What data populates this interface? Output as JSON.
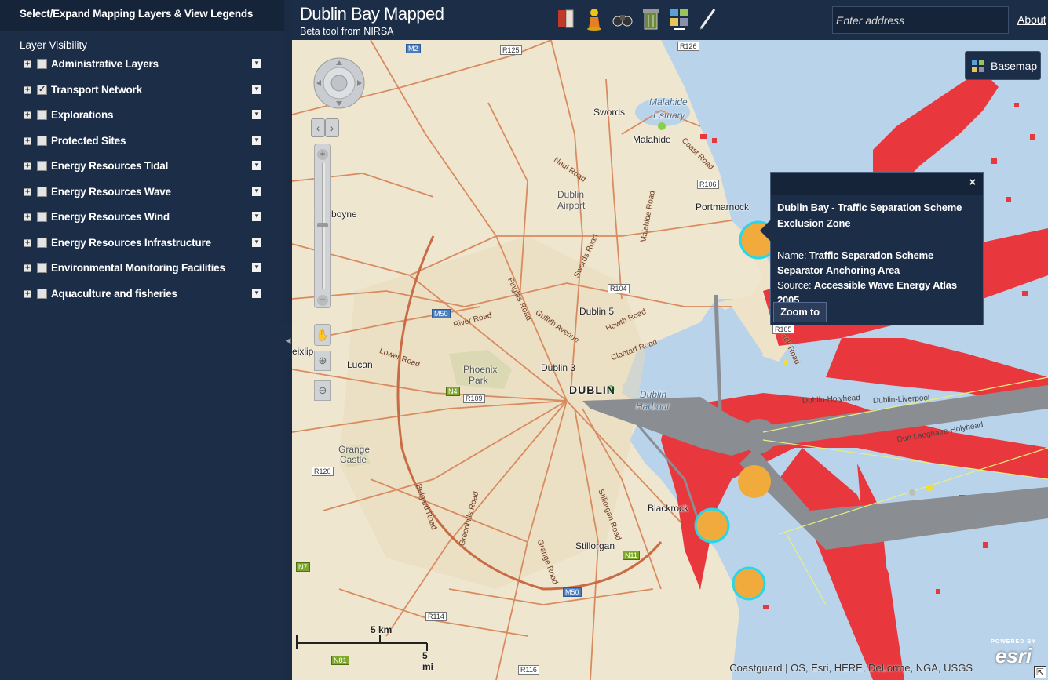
{
  "sidebar": {
    "header": "Select/Expand Mapping Layers & View Legends",
    "section_title": "Layer Visibility",
    "layers": [
      {
        "label": "Administrative Layers",
        "checked": false
      },
      {
        "label": "Transport Network",
        "checked": true
      },
      {
        "label": "Explorations",
        "checked": false
      },
      {
        "label": "Protected Sites",
        "checked": false
      },
      {
        "label": "Energy Resources Tidal",
        "checked": false
      },
      {
        "label": "Energy Resources Wave",
        "checked": false
      },
      {
        "label": "Energy Resources Wind",
        "checked": false
      },
      {
        "label": "Energy Resources Infrastructure",
        "checked": false
      },
      {
        "label": "Environmental Monitoring Facilities",
        "checked": false
      },
      {
        "label": "Aquaculture and fisheries",
        "checked": false
      }
    ],
    "expander_symbol": "+",
    "check_symbol": "✓",
    "dropdown_symbol": "▼"
  },
  "header": {
    "title": "Dublin Bay Mapped",
    "subtitle": "Beta tool from NIRSA",
    "address_placeholder": "Enter address",
    "about_label": "About",
    "tools": [
      "book-icon",
      "person-icon",
      "binoculars-icon",
      "trash-icon",
      "grid-icon",
      "pencil-icon"
    ]
  },
  "map": {
    "basemap_label": "Basemap",
    "places": {
      "swords": "Swords",
      "malahide": "Malahide",
      "malahide_estuary_1": "Malahide",
      "malahide_estuary_2": "Estuary",
      "dublin_airport_1": "Dublin",
      "dublin_airport_2": "Airport",
      "portmarnock": "Portmarnock",
      "dunboyne": "Dunboyne",
      "dublin5": "Dublin 5",
      "dublin3": "Dublin 3",
      "lucan": "Lucan",
      "phoenix_1": "Phoenix",
      "phoenix_2": "Park",
      "dublin": "DUBLIN",
      "dublin_harbour_1": "Dublin",
      "dublin_harbour_2": "Harbour",
      "grange_1": "Grange",
      "grange_2": "Castle",
      "blackrock": "Blackrock",
      "stillorgan": "Stillorgan",
      "leixlip": "eixlip"
    },
    "roads": {
      "naul": "Naul Road",
      "malahide_road": "Malahide Road",
      "swords_road": "Swords Road",
      "finglas_road": "Finglas Road",
      "griffith": "Griffith Avenue",
      "river_road": "River Road",
      "lower_road": "Lower Road",
      "howth_road": "Howth Road",
      "clontarf_road": "Clontarf Road",
      "belgard": "Belgard Road",
      "greenhills": "Greenhills Road",
      "stillorgan_road": "Stillorgan Road",
      "grange_road": "Grange Road",
      "carrickbrack": "Carrickbrack Road",
      "coast_road": "Coast Road",
      "shipping_1": "Dublin-Holyhead",
      "shipping_2": "Dublin-Liverpool",
      "shipping_3": "Dun Laoghaire-Holyhead"
    },
    "shields": {
      "m2": "M2",
      "r125": "R125",
      "r126": "R126",
      "r106": "R106",
      "r104": "R104",
      "m50a": "M50",
      "n4": "N4",
      "r109": "R109",
      "r120": "R120",
      "n7": "N7",
      "n11": "N11",
      "m50b": "M50",
      "r114": "R114",
      "n81": "N81",
      "r116": "R116",
      "r105": "R105"
    },
    "scale_km": "5 km",
    "scale_mi": "5 mi",
    "attribution": "Coastguard | OS, Esri, HERE, DeLorme, NGA, USGS",
    "esri_powered": "POWERED BY",
    "esri_text": "esri"
  },
  "popup": {
    "close_symbol": "×",
    "heading": "Dublin Bay - Traffic Separation Scheme Exclusion Zone",
    "name_label": "Name:",
    "name_value": "Traffic Separation Scheme Separator Anchoring Area",
    "source_label": "Source:",
    "source_value": "Accessible Wave Energy Atlas 2005",
    "zoom_to_label": "Zoom to"
  },
  "colors": {
    "panel": "#1c2d47",
    "sea": "#b9d3ea",
    "land": "#efe6cf",
    "roads": "#d98b5f",
    "exclusion_zone": "#e8383d",
    "shipping_lane": "#8a8d92",
    "anchorage": "#f0ab3c",
    "anchorage_outline": "#27d7e8"
  }
}
